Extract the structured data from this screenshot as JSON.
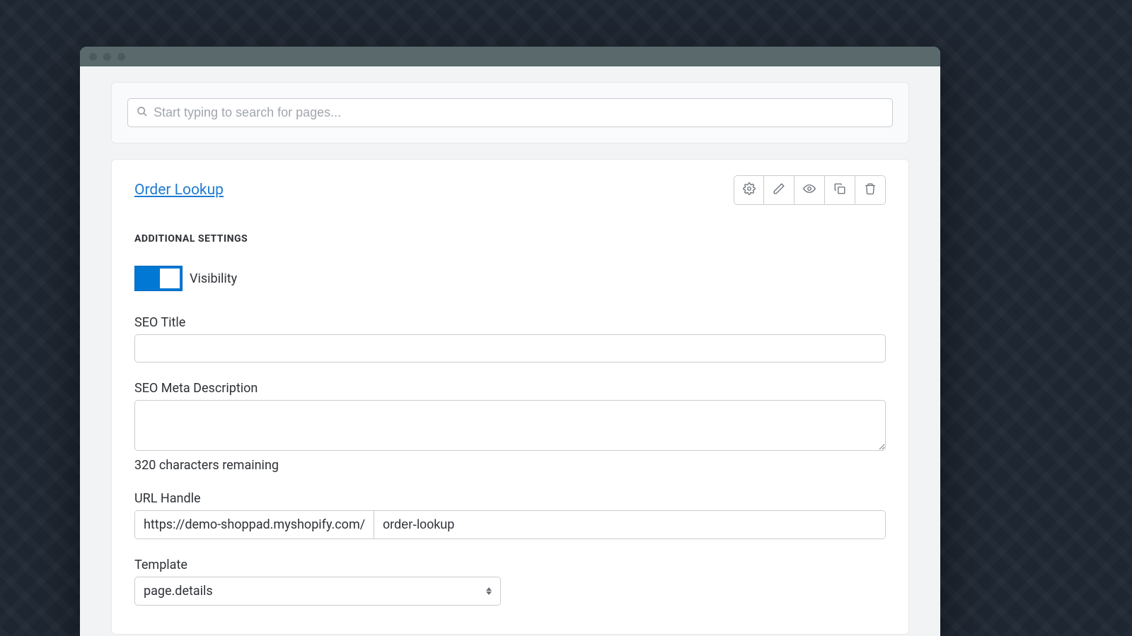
{
  "search": {
    "placeholder": "Start typing to search for pages..."
  },
  "page": {
    "title": "Order Lookup"
  },
  "section": {
    "heading": "ADDITIONAL SETTINGS"
  },
  "visibility": {
    "label": "Visibility",
    "on": true
  },
  "fields": {
    "seo_title": {
      "label": "SEO Title",
      "value": ""
    },
    "seo_meta": {
      "label": "SEO Meta Description",
      "value": "",
      "helper": "320 characters remaining"
    },
    "url_handle": {
      "label": "URL Handle",
      "prefix": "https://demo-shoppad.myshopify.com/",
      "value": "order-lookup"
    },
    "template": {
      "label": "Template",
      "value": "page.details"
    }
  },
  "icons": {
    "gear": "gear-icon",
    "pencil": "pencil-icon",
    "eye": "eye-icon",
    "copy": "copy-icon",
    "trash": "trash-icon"
  }
}
